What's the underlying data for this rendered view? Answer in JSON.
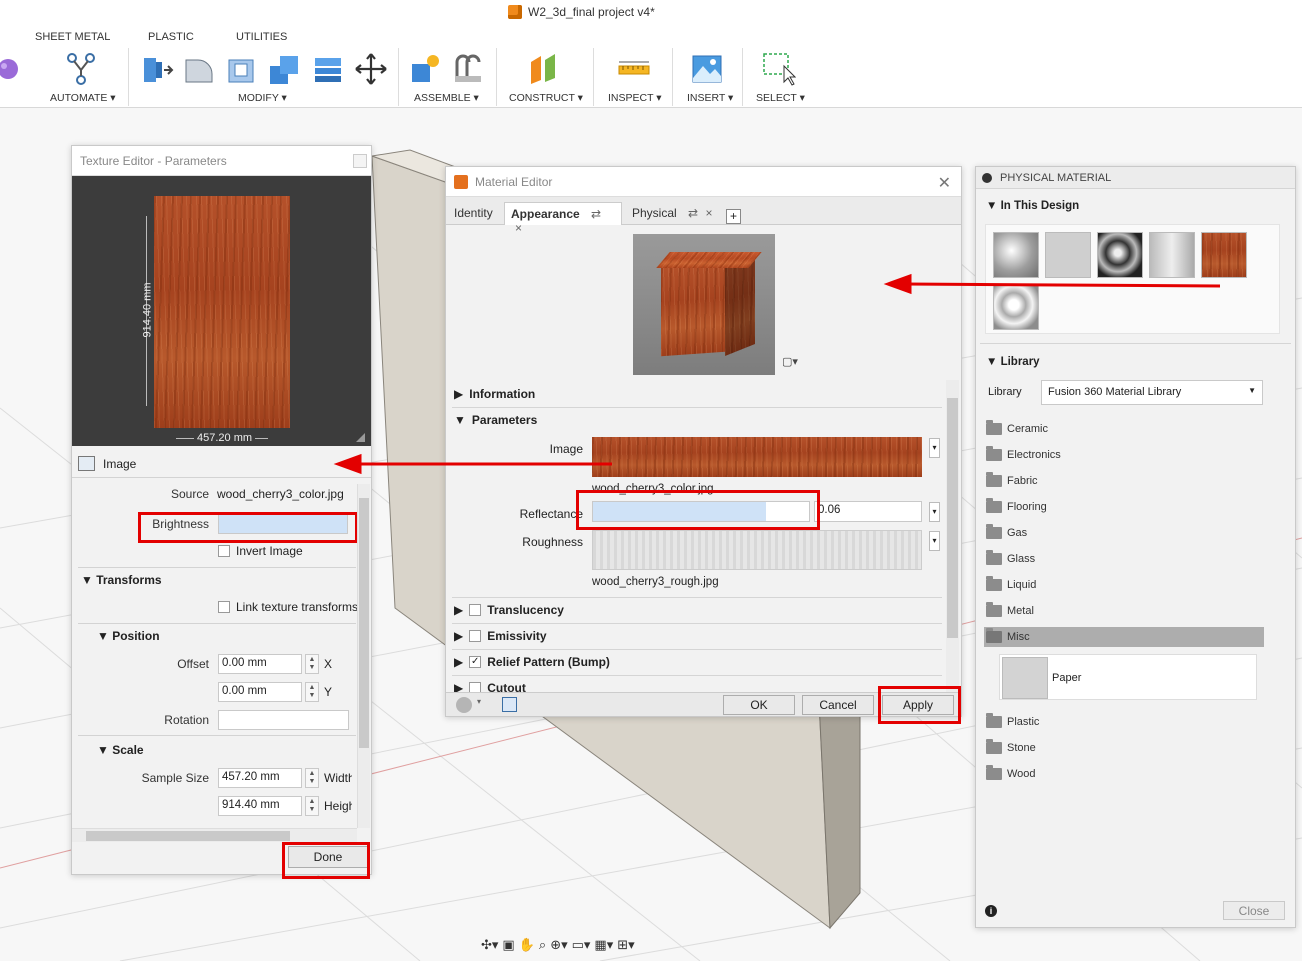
{
  "window": {
    "title": "W2_3d_final project v4*"
  },
  "ribbon": {
    "tabs": [
      "SHEET METAL",
      "PLASTIC",
      "UTILITIES"
    ],
    "groups": [
      "AUTOMATE ▾",
      "MODIFY ▾",
      "ASSEMBLE ▾",
      "CONSTRUCT ▾",
      "INSPECT ▾",
      "INSERT ▾",
      "SELECT ▾"
    ]
  },
  "texture_editor": {
    "title": "Texture Editor - Parameters",
    "height_dim": "914.40 mm",
    "width_dim": "457.20 mm",
    "image_label": "Image",
    "source_label": "Source",
    "source_value": "wood_cherry3_color.jpg",
    "brightness_label": "Brightness",
    "invert_label": "Invert Image",
    "transforms_label": "Transforms",
    "link_label": "Link texture transforms",
    "position_label": "Position",
    "offset_label": "Offset",
    "offset_x": "0.00 mm",
    "offset_y": "0.00 mm",
    "axis_x": "X",
    "axis_y": "Y",
    "rotation_label": "Rotation",
    "scale_label": "Scale",
    "sample_size_label": "Sample Size",
    "sample_width": "457.20 mm",
    "sample_height": "914.40 mm",
    "width_label": "Width",
    "height_label": "Height",
    "done_label": "Done"
  },
  "material_editor": {
    "title": "Material Editor",
    "tabs": {
      "identity": "Identity",
      "appearance": "Appearance",
      "physical": "Physical",
      "add": "+"
    },
    "information_label": "Information",
    "parameters_label": "Parameters",
    "image_label": "Image",
    "image_file": "wood_cherry3_color.jpg",
    "reflectance_label": "Reflectance",
    "reflectance_value": "0.06",
    "reflectance_fill": 0.8,
    "roughness_label": "Roughness",
    "roughness_file": "wood_cherry3_rough.jpg",
    "translucency_label": "Translucency",
    "emissivity_label": "Emissivity",
    "relief_label": "Relief Pattern (Bump)",
    "cutout_label": "Cutout",
    "ok_label": "OK",
    "cancel_label": "Cancel",
    "apply_label": "Apply"
  },
  "physical_material": {
    "title": "PHYSICAL MATERIAL",
    "in_design_label": "In This Design",
    "library_section": "Library",
    "library_label": "Library",
    "library_value": "Fusion 360 Material Library",
    "folders": [
      "Ceramic",
      "Electronics",
      "Fabric",
      "Flooring",
      "Gas",
      "Glass",
      "Liquid",
      "Metal",
      "Misc"
    ],
    "misc_item": "Paper",
    "folders_after": [
      "Plastic",
      "Stone",
      "Wood"
    ],
    "close_label": "Close"
  },
  "colors": {
    "annotation_red": "#e30000",
    "wood": "#b5512a",
    "selection": "#cfe2f7"
  }
}
